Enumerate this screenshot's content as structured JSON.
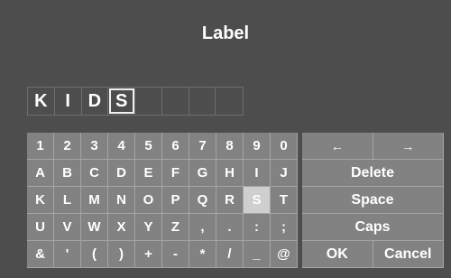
{
  "title": "Label",
  "entry": {
    "chars": [
      "K",
      "I",
      "D",
      "S",
      "",
      "",
      "",
      ""
    ],
    "cursor_index": 3
  },
  "keyboard": {
    "rows": [
      [
        "1",
        "2",
        "3",
        "4",
        "5",
        "6",
        "7",
        "8",
        "9",
        "0"
      ],
      [
        "A",
        "B",
        "C",
        "D",
        "E",
        "F",
        "G",
        "H",
        "I",
        "J"
      ],
      [
        "K",
        "L",
        "M",
        "N",
        "O",
        "P",
        "Q",
        "R",
        "S",
        "T"
      ],
      [
        "U",
        "V",
        "W",
        "X",
        "Y",
        "Z",
        ",",
        ".",
        ":",
        ";"
      ],
      [
        "&",
        "'",
        "(",
        ")",
        "+",
        "-",
        "*",
        "/",
        "_",
        "@"
      ]
    ],
    "selected": "S"
  },
  "actions": {
    "left_arrow": "←",
    "right_arrow": "→",
    "delete": "Delete",
    "space": "Space",
    "caps": "Caps",
    "ok": "OK",
    "cancel": "Cancel"
  }
}
